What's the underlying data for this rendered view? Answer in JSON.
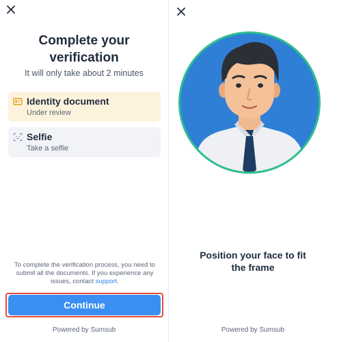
{
  "left": {
    "title_line1": "Complete your",
    "title_line2": "verification",
    "subtitle": "It will only take about 2 minutes",
    "steps": [
      {
        "title": "Identity document",
        "status": "Under review",
        "icon": "id-card-icon"
      },
      {
        "title": "Selfie",
        "status": "Take a selfie",
        "icon": "face-scan-icon"
      }
    ],
    "notice_text": "To complete the verification process, you need to submit all the documents. If you experience any issues, contact",
    "notice_link": "support",
    "notice_end": ".",
    "continue_label": "Continue",
    "powered_by": "Powered by Sumsub"
  },
  "right": {
    "instruction_line1": "Position your face to fit",
    "instruction_line2": "the frame",
    "powered_by": "Powered by Sumsub"
  },
  "colors": {
    "accent": "#3b8ff2",
    "highlight": "#e84a3b",
    "id_card_bg": "#fdf3dd",
    "selfie_card_bg": "#f1f3f7",
    "frame_ring": "#2fbf8e",
    "frame_bg": "#2f7fd6"
  },
  "icons": [
    "close-icon",
    "id-card-icon",
    "face-scan-icon",
    "avatar-illustration"
  ]
}
